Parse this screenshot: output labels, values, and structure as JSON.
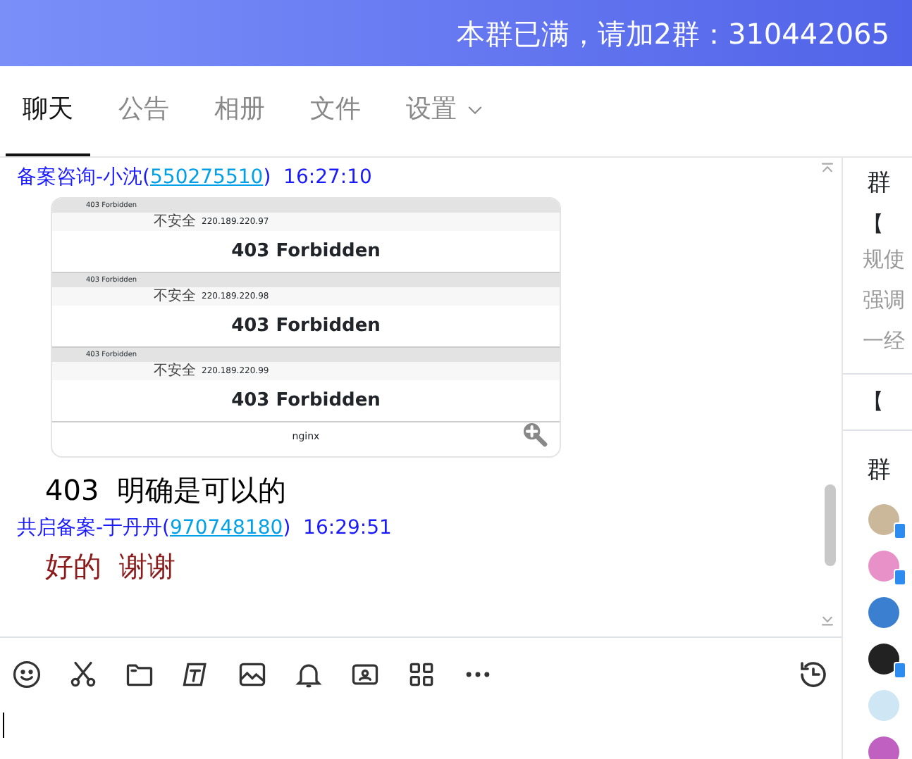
{
  "header": {
    "notice": "本群已满，请加2群：310442065"
  },
  "tabs": [
    {
      "label": "聊天",
      "selected": true,
      "dropdown": false
    },
    {
      "label": "公告",
      "selected": false,
      "dropdown": false
    },
    {
      "label": "相册",
      "selected": false,
      "dropdown": false
    },
    {
      "label": "文件",
      "selected": false,
      "dropdown": false
    },
    {
      "label": "设置",
      "selected": false,
      "dropdown": true
    }
  ],
  "messages": [
    {
      "kind": "header",
      "sender": "备案咨询-小沈(",
      "qq": "550275510",
      "suffix": ")",
      "time": "16:27:10"
    },
    {
      "kind": "image",
      "windows": [
        {
          "tab_title": "403 Forbidden",
          "security": "不安全",
          "url": "220.189.220.97",
          "heading": "403 Forbidden"
        },
        {
          "tab_title": "403 Forbidden",
          "security": "不安全",
          "url": "220.189.220.98",
          "heading": "403 Forbidden"
        },
        {
          "tab_title": "403 Forbidden",
          "security": "不安全",
          "url": "220.189.220.99",
          "heading": "403 Forbidden"
        }
      ],
      "footer": "nginx"
    },
    {
      "kind": "text",
      "text": "403  明确是可以的",
      "color": "#000000"
    },
    {
      "kind": "header",
      "sender": "共启备案-于丹丹(",
      "qq": "970748180",
      "suffix": ")",
      "time": "16:29:51"
    },
    {
      "kind": "text",
      "text": "好的  谢谢",
      "color": "#8b1a1a"
    }
  ],
  "side": {
    "title": "群",
    "notice_label": "【",
    "notice_lines": [
      "规使",
      "强调",
      "一经"
    ],
    "files_label": "【",
    "members_title": "群",
    "members": [
      {
        "mobile": true
      },
      {
        "mobile": true
      },
      {
        "mobile": false
      },
      {
        "mobile": true
      },
      {
        "mobile": false
      },
      {
        "mobile": false
      }
    ]
  }
}
